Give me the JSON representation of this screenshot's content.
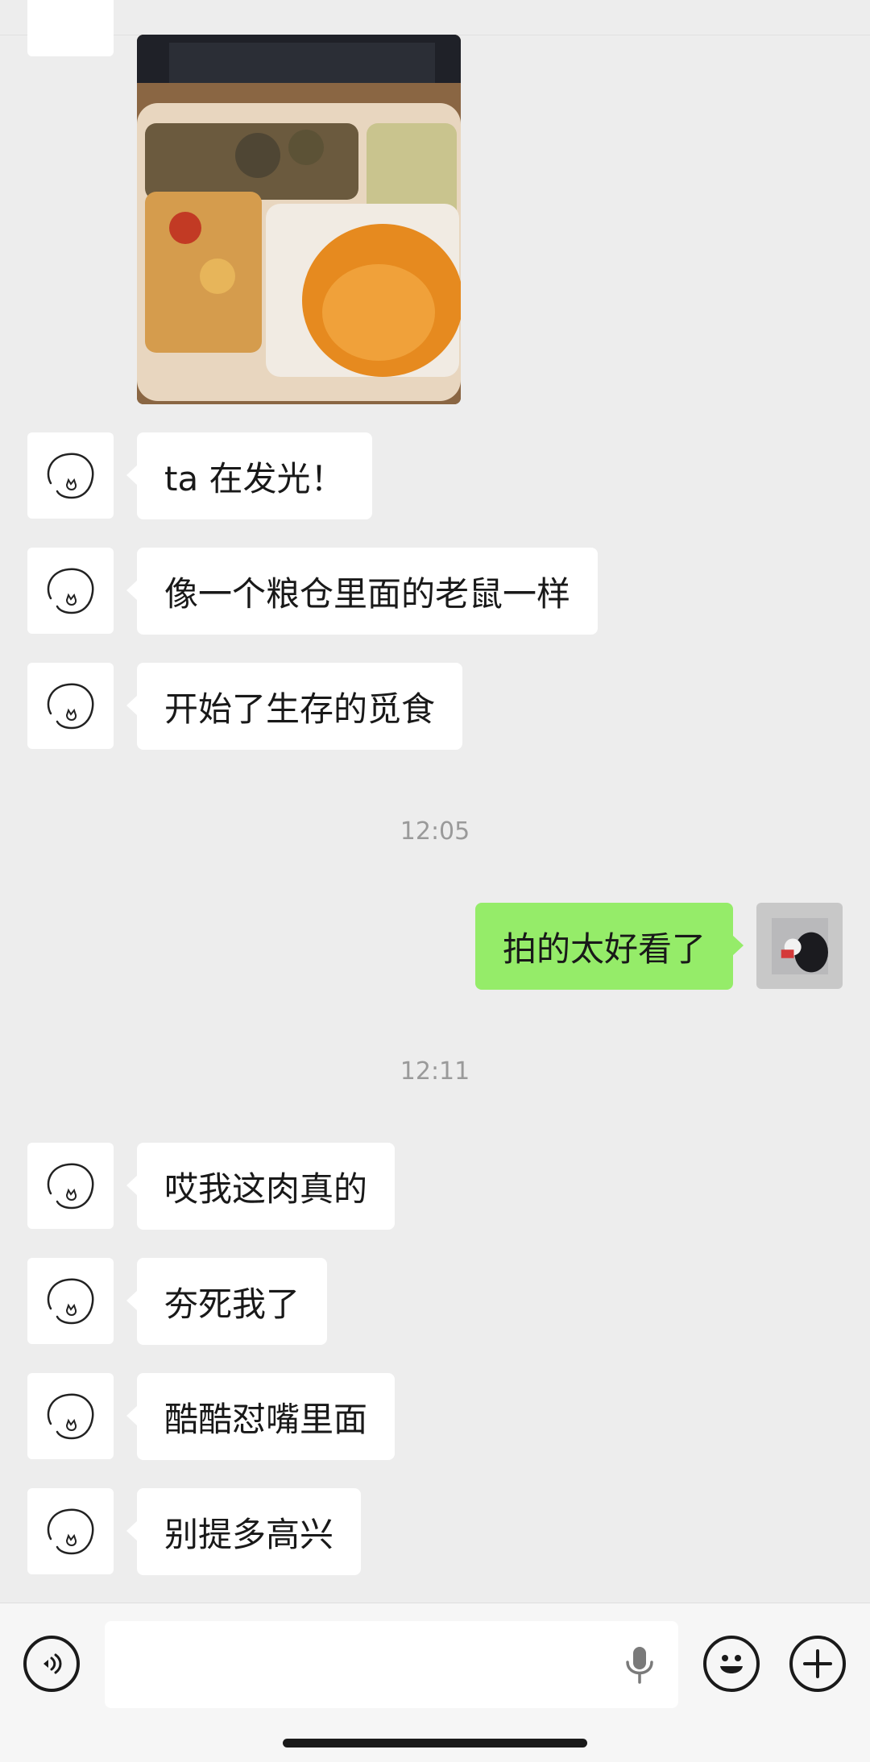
{
  "messages": [
    {
      "side": "in",
      "text": "ta 在发光！"
    },
    {
      "side": "in",
      "text": "像一个粮仓里面的老鼠一样"
    },
    {
      "side": "in",
      "text": "开始了生存的觅食"
    },
    {
      "side": "out",
      "text": "拍的太好看了"
    },
    {
      "side": "in",
      "text": "哎我这肉真的"
    },
    {
      "side": "in",
      "text": "夯死我了"
    },
    {
      "side": "in",
      "text": "酷酷怼嘴里面"
    },
    {
      "side": "in",
      "text": "别提多高兴"
    }
  ],
  "timestamps": [
    "12:05",
    "12:11"
  ],
  "photo": {
    "icon": "lunch-box-photo"
  },
  "contact_avatar_icon": "doodle-cat-icon",
  "own_avatar_icon": "dog-photo-avatar",
  "input": {
    "value": "",
    "placeholder": ""
  },
  "colors": {
    "background": "#ededed",
    "bubble_incoming": "#ffffff",
    "bubble_outgoing": "#95ec69",
    "timestamp": "#9a9a9a"
  },
  "toolbar": {
    "voice_icon": "voice-mode-icon",
    "mic_icon": "microphone-icon",
    "emoji_icon": "emoji-icon",
    "plus_icon": "plus-icon"
  }
}
